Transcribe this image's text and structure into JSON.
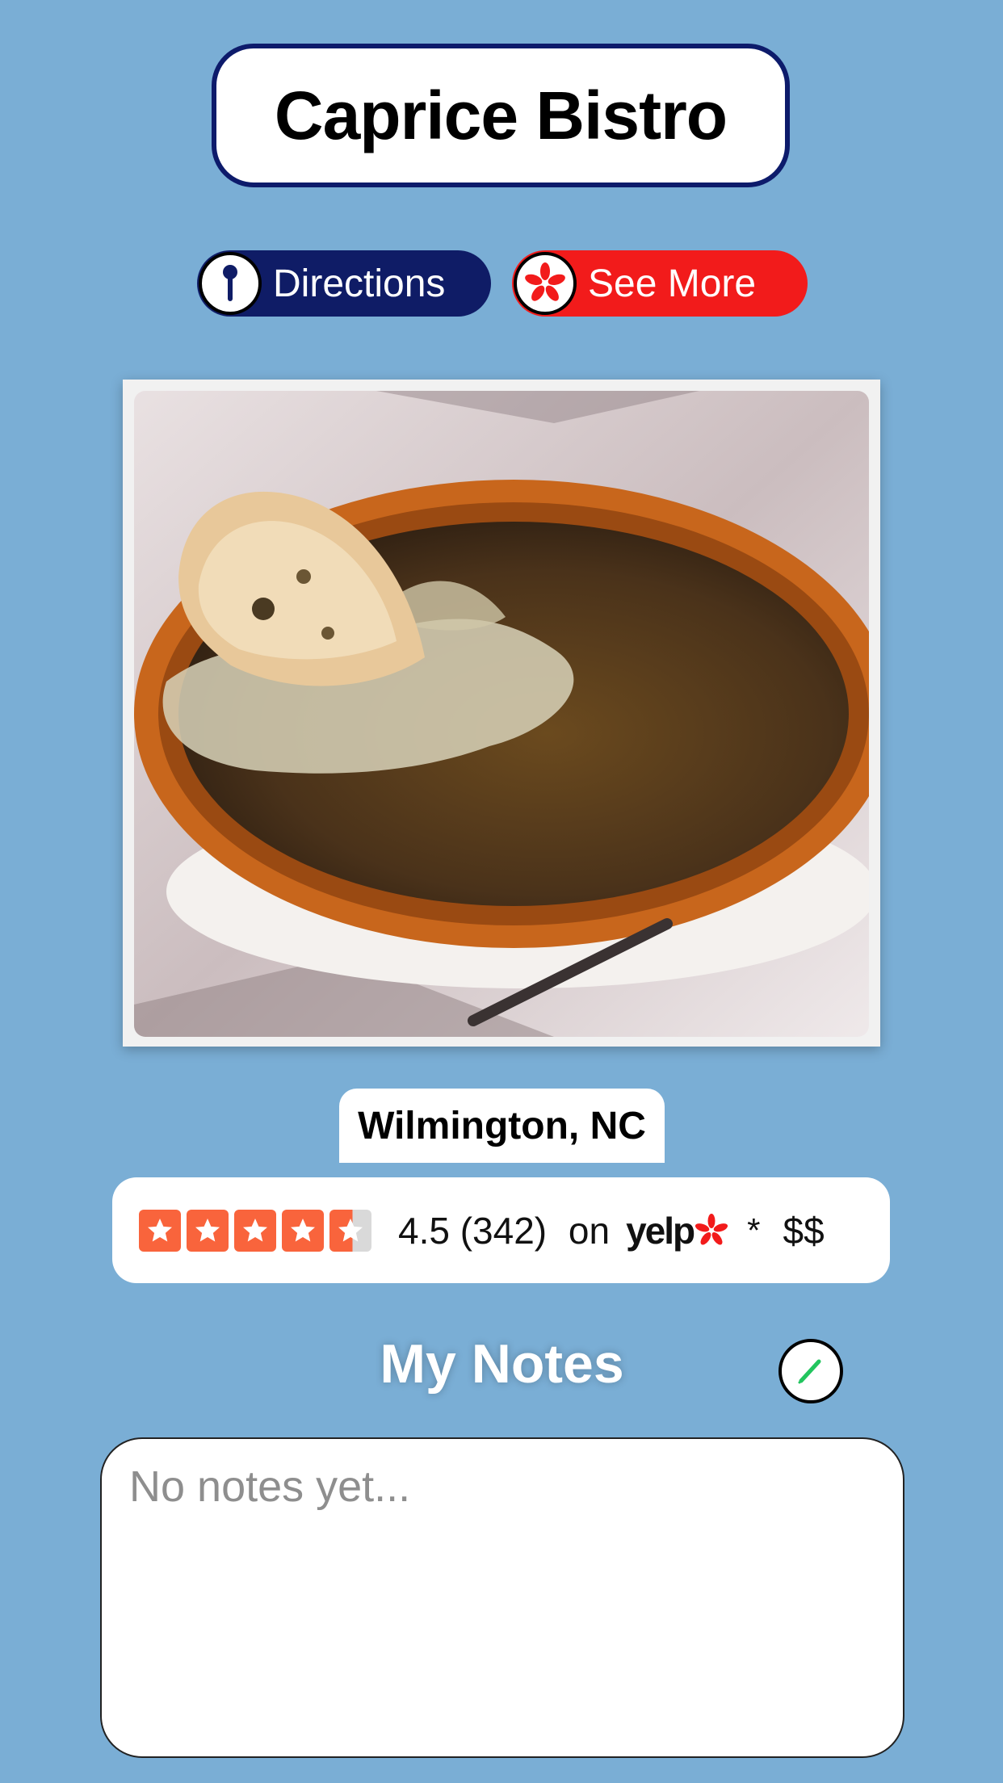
{
  "restaurant": {
    "name": "Caprice Bistro"
  },
  "actions": {
    "directions_label": "Directions",
    "see_more_label": "See More"
  },
  "location": "Wilmington, NC",
  "rating": {
    "stars": 4.5,
    "score": "4.5",
    "reviews": "(342)",
    "on_label": "on",
    "source": "yelp",
    "separator": "*",
    "price": "$$"
  },
  "notes": {
    "title": "My Notes",
    "placeholder": "No notes yet..."
  },
  "colors": {
    "background": "#7aaed5",
    "directions": "#0f1c66",
    "see_more": "#f21b1b",
    "yelp_star": "#f9643c",
    "edit_pencil": "#22c55e"
  },
  "icons": {
    "directions": "map-pin-icon",
    "see_more": "yelp-burst-icon",
    "edit": "pencil-icon"
  }
}
